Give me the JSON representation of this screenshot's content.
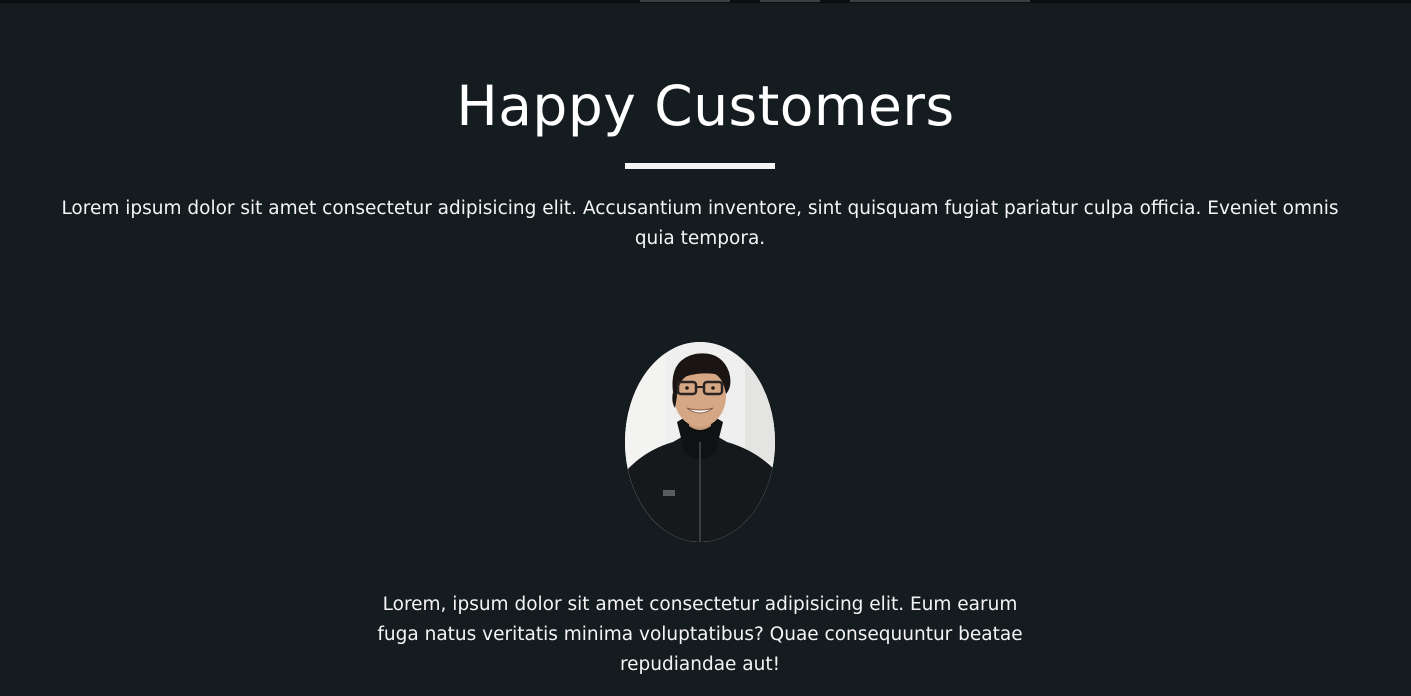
{
  "section": {
    "title": "Happy Customers",
    "intro_text": "Lorem ipsum dolor sit amet consectetur adipisicing elit. Accusantium inventore, sint quisquam fugiat pariatur culpa officia. Eveniet omnis quia tempora."
  },
  "testimonial": {
    "avatar_icon": "customer-photo",
    "quote": "Lorem, ipsum dolor sit amet consectetur adipisicing elit. Eum earum fuga natus veritatis minima voluptatibus? Quae consequuntur beatae repudiandae aut!"
  },
  "colors": {
    "background": "#141c1f",
    "text": "#ffffff",
    "rule": "#f4f4f4"
  }
}
